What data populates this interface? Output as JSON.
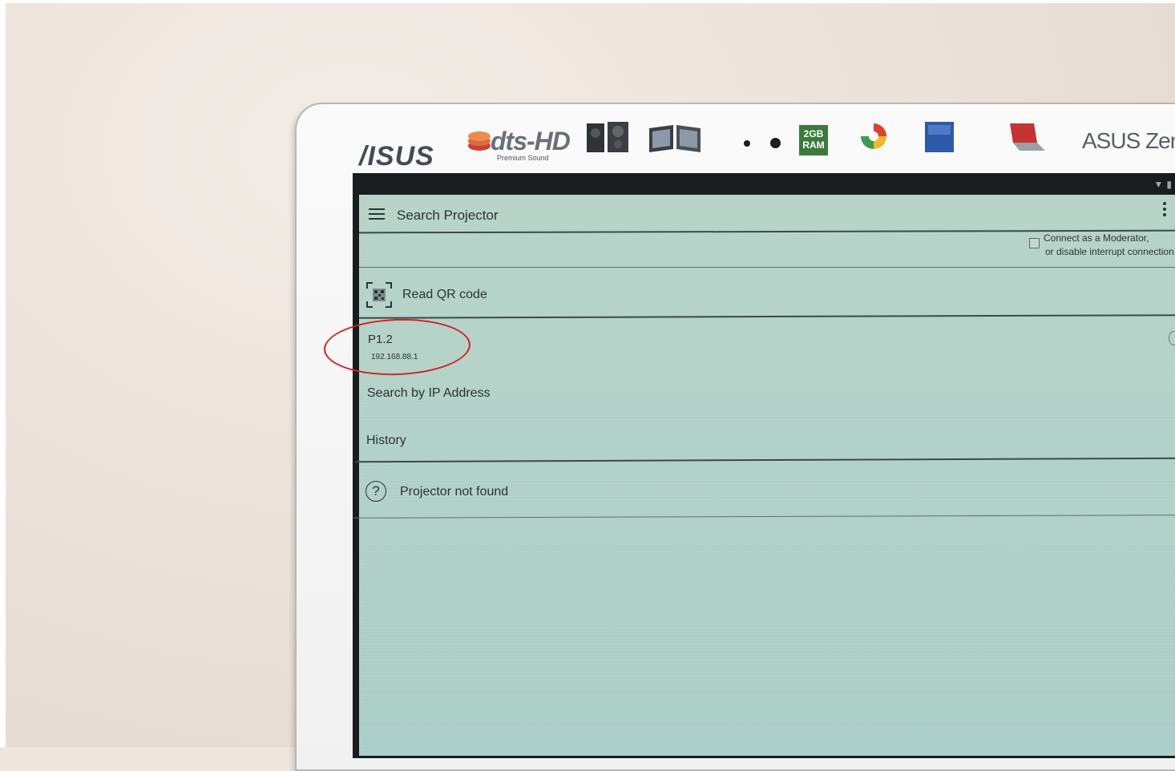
{
  "device": {
    "brand": "/ISUS",
    "dts_logo": "dts-HD",
    "dts_caption": "Premium Sound",
    "ram_badge": "2GB RAM",
    "model": "ASUS ZenP"
  },
  "app": {
    "title": "Search Projector",
    "moderator_option_line1": "Connect as a Moderator,",
    "moderator_option_line2": "or disable interrupt connection",
    "read_qr_label": "Read QR code",
    "projector_name": "P1.2",
    "projector_ip": "192.168.88.1",
    "search_by_ip_label": "Search by IP Address",
    "history_label": "History",
    "projector_not_found": "Projector not found",
    "help_glyph": "?"
  },
  "icons": [
    "menu-icon",
    "more-vert-icon",
    "qr-code-icon",
    "help-circle-icon",
    "wifi-icon",
    "battery-icon"
  ],
  "colors": {
    "screen_bg": "#b2d1c8",
    "divider": "#3a4a48",
    "text": "#2a3433",
    "annotation": "#d42222"
  }
}
